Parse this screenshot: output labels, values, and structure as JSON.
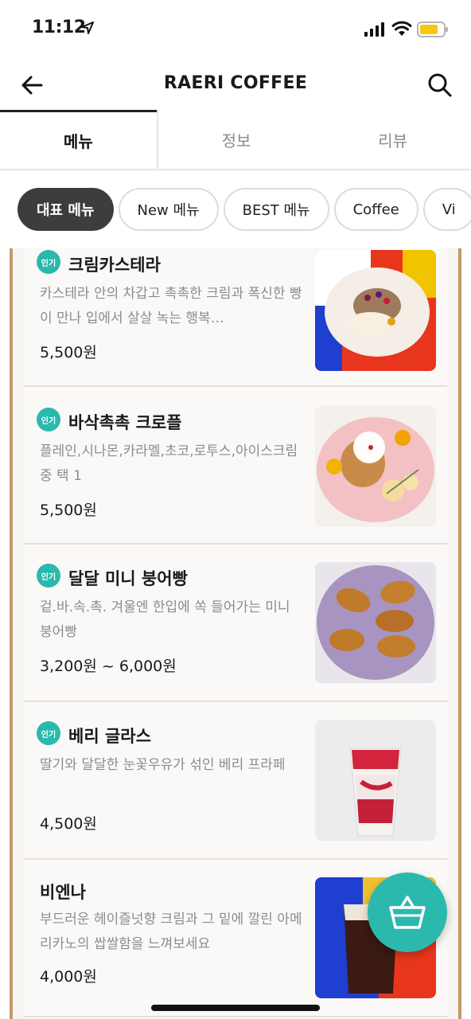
{
  "status_bar": {
    "time": "11:12"
  },
  "header": {
    "title": "RAERI COFFEE"
  },
  "tabs": [
    {
      "label": "메뉴",
      "active": true
    },
    {
      "label": "정보",
      "active": false
    },
    {
      "label": "리뷰",
      "active": false
    }
  ],
  "chips": [
    {
      "label": "대표 메뉴",
      "active": true
    },
    {
      "label": "New 메뉴",
      "active": false
    },
    {
      "label": "BEST 메뉴",
      "active": false
    },
    {
      "label": "Coffee",
      "active": false
    },
    {
      "label": "Vi",
      "active": false
    }
  ],
  "menu_items": [
    {
      "badge": "인기",
      "name": "크림카스테라",
      "desc": "카스테라 안의 차갑고 촉촉한 크림과 폭신한 빵이 만나 입에서 살살 녹는 행복…",
      "price": "5,500원"
    },
    {
      "badge": "인기",
      "name": "바삭촉촉 크로플",
      "desc": "플레인,시나몬,카라멜,초코,로투스,아이스크림 중 택 1",
      "price": "5,500원"
    },
    {
      "badge": "인기",
      "name": "달달 미니 붕어빵",
      "desc": "겉.바.속.촉. 겨울엔 한입에 쏙 들어가는 미니 붕어빵",
      "price": "3,200원 ~ 6,000원"
    },
    {
      "badge": "인기",
      "name": "베리 글라스",
      "desc": "딸기와 달달한 눈꽃우유가 섞인 베리 프라페",
      "price": "4,500원"
    },
    {
      "badge": "",
      "name": "비엔나",
      "desc": "부드러운 헤이즐넛향 크림과 그 밑에 깔린 아메리카노의 쌉쌀함을 느껴보세요",
      "price": "4,000원"
    }
  ],
  "colors": {
    "accent": "#2bb9ad",
    "frame": "#c39a66",
    "chip_active": "#3d3d3d"
  },
  "icons": [
    "location-arrow-icon",
    "signal-icon",
    "wifi-icon",
    "battery-icon",
    "back-arrow-icon",
    "search-icon",
    "basket-icon"
  ]
}
